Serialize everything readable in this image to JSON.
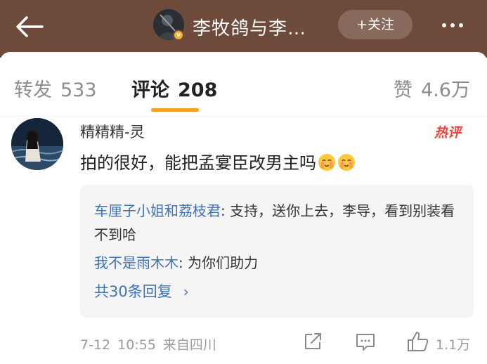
{
  "header": {
    "title": "李牧鸽与李…",
    "follow_label": "+关注",
    "verified_badge": "v"
  },
  "tabs": [
    {
      "label": "转发",
      "count": "533"
    },
    {
      "label": "评论",
      "count": "208"
    },
    {
      "label": "赞",
      "count": "4.6万"
    }
  ],
  "comment": {
    "username": "精精精-灵",
    "hot_tag": "热评",
    "text": "拍的很好，能把孟宴臣改男主吗",
    "emoji_icon": "blush-face-emoji",
    "replies": [
      {
        "user": "车厘子小姐和荔枝君",
        "text": ": 支持，送你上去，李导，看到别装看不到哈"
      },
      {
        "user": "我不是雨木木",
        "text": ": 为你们助力"
      }
    ],
    "more_replies": "共30条回复",
    "date": "7-12",
    "time": "10:55",
    "location": "来自四川",
    "like_count": "1.1万"
  },
  "colors": {
    "header_bg": "#6e4a3a",
    "accent": "#f7a020",
    "link": "#3f72b8",
    "hot": "#e8463b"
  }
}
